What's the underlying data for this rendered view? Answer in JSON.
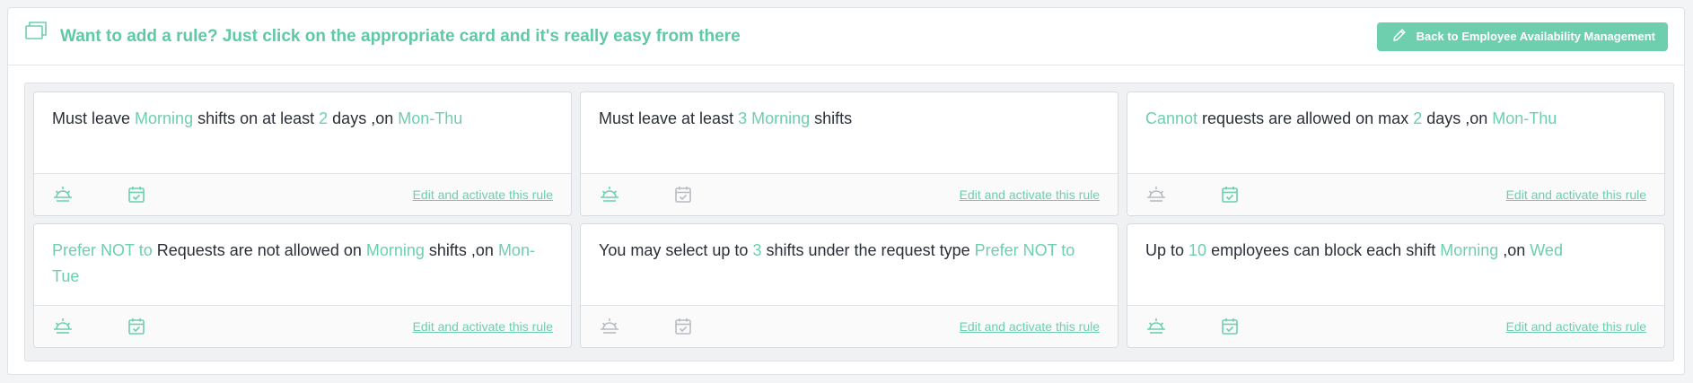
{
  "header": {
    "title": "Want to add a rule? Just click on the appropriate card and it's really easy from there",
    "back_button_label": "Back to Employee Availability Management"
  },
  "colors": {
    "accent": "#6dcfad",
    "text": "#2b2f38",
    "inactive_icon": "#b8bcc2"
  },
  "cards": [
    {
      "segments": [
        {
          "text": "Must leave ",
          "hl": false
        },
        {
          "text": "Morning",
          "hl": true
        },
        {
          "text": " shifts on at least ",
          "hl": false
        },
        {
          "text": "2",
          "hl": true
        },
        {
          "text": " days ,on ",
          "hl": false
        },
        {
          "text": "Mon-Thu",
          "hl": true
        }
      ],
      "sun_icon_active": true,
      "calendar_icon_active": true,
      "link_label": "Edit and activate this rule"
    },
    {
      "segments": [
        {
          "text": "Must leave at least ",
          "hl": false
        },
        {
          "text": "3",
          "hl": true
        },
        {
          "text": " ",
          "hl": false
        },
        {
          "text": "Morning",
          "hl": true
        },
        {
          "text": " shifts",
          "hl": false
        }
      ],
      "sun_icon_active": true,
      "calendar_icon_active": false,
      "link_label": "Edit and activate this rule"
    },
    {
      "segments": [
        {
          "text": "Cannot",
          "hl": true
        },
        {
          "text": " requests are allowed on max ",
          "hl": false
        },
        {
          "text": "2",
          "hl": true
        },
        {
          "text": " days ,on ",
          "hl": false
        },
        {
          "text": "Mon-Thu",
          "hl": true
        }
      ],
      "sun_icon_active": false,
      "calendar_icon_active": true,
      "link_label": "Edit and activate this rule"
    },
    {
      "segments": [
        {
          "text": "Prefer NOT to",
          "hl": true
        },
        {
          "text": " Requests are not allowed on ",
          "hl": false
        },
        {
          "text": "Morning",
          "hl": true
        },
        {
          "text": " shifts ,on ",
          "hl": false
        },
        {
          "text": "Mon-Tue",
          "hl": true
        }
      ],
      "sun_icon_active": true,
      "calendar_icon_active": true,
      "link_label": "Edit and activate this rule"
    },
    {
      "segments": [
        {
          "text": "You may select up to ",
          "hl": false
        },
        {
          "text": "3",
          "hl": true
        },
        {
          "text": " shifts under the request type ",
          "hl": false
        },
        {
          "text": "Prefer NOT to",
          "hl": true
        }
      ],
      "sun_icon_active": false,
      "calendar_icon_active": false,
      "link_label": "Edit and activate this rule"
    },
    {
      "segments": [
        {
          "text": "Up to ",
          "hl": false
        },
        {
          "text": "10",
          "hl": true
        },
        {
          "text": " employees can block each shift ",
          "hl": false
        },
        {
          "text": "Morning",
          "hl": true
        },
        {
          "text": " ,on ",
          "hl": false
        },
        {
          "text": "Wed",
          "hl": true
        }
      ],
      "sun_icon_active": true,
      "calendar_icon_active": true,
      "link_label": "Edit and activate this rule"
    }
  ]
}
